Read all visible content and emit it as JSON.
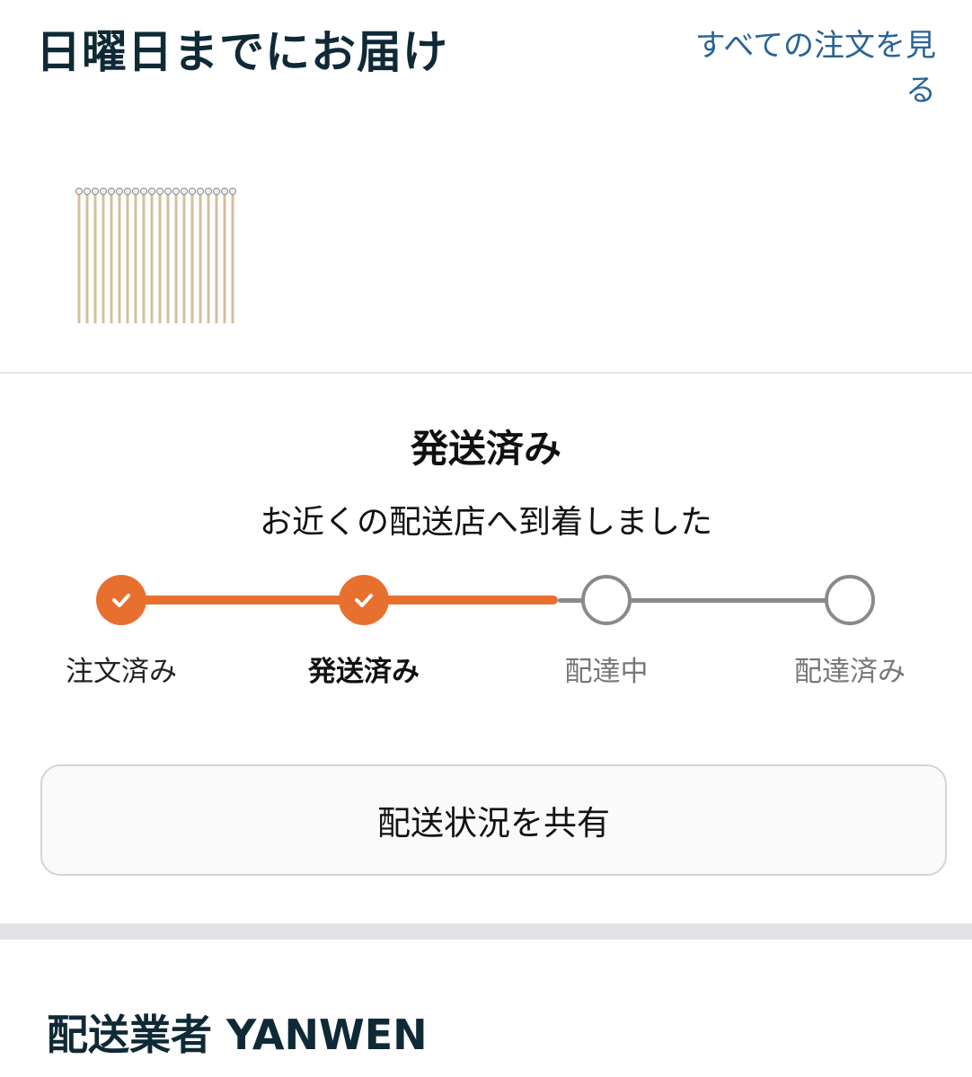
{
  "header": {
    "delivery_title": "日曜日までにお届け",
    "view_all_link": "すべての注文を見る"
  },
  "product": {
    "image_icon": "pins-product-image"
  },
  "status": {
    "title": "発送済み",
    "subtitle": "お近くの配送店へ到着しました"
  },
  "progress": {
    "steps": [
      {
        "label": "注文済み",
        "state": "done"
      },
      {
        "label": "発送済み",
        "state": "current"
      },
      {
        "label": "配達中",
        "state": "pending"
      },
      {
        "label": "配達済み",
        "state": "pending"
      }
    ],
    "completed_fraction": 0.5,
    "accent_color": "#e8702f",
    "pending_color": "#8a8a8a"
  },
  "share_button": {
    "label": "配送状況を共有"
  },
  "carrier": {
    "title": "配送業者 YANWEN"
  }
}
